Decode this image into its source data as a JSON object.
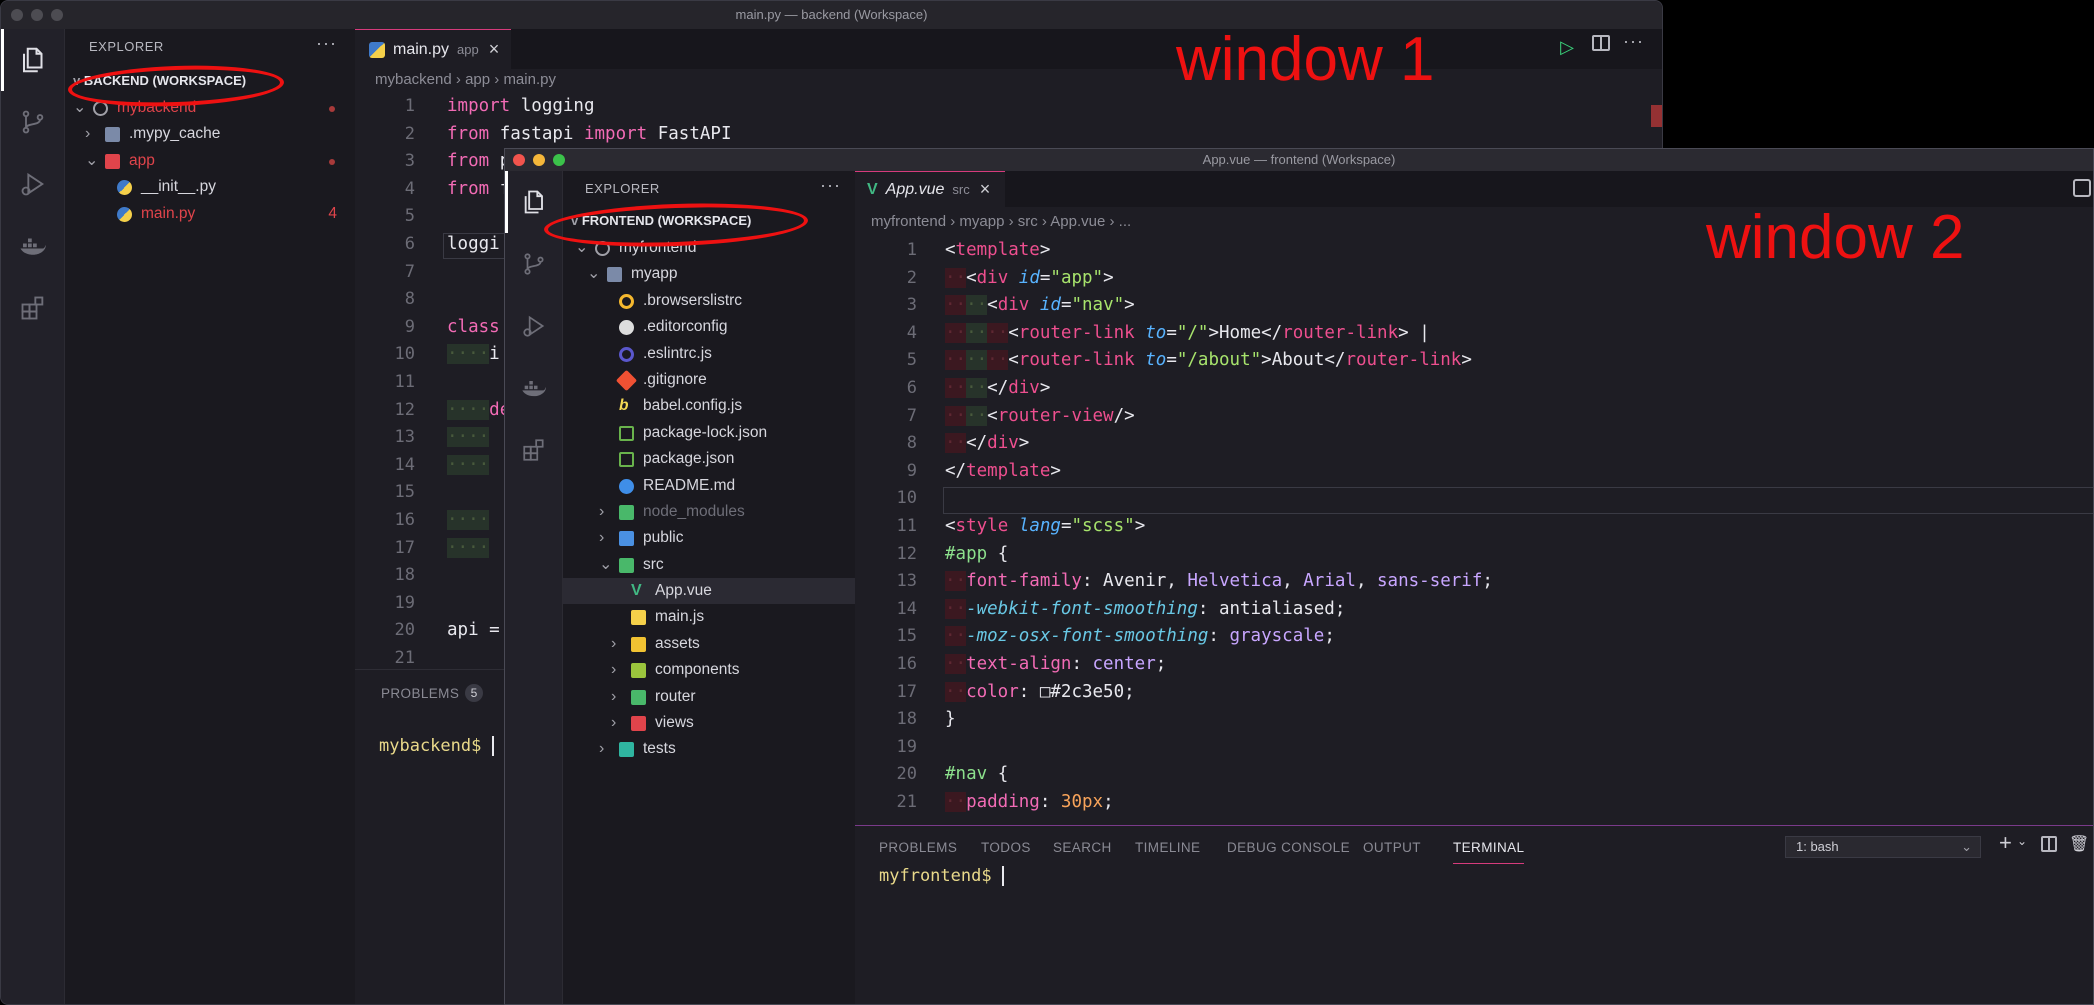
{
  "win1": {
    "title": "main.py — backend (Workspace)",
    "explorer_label": "EXPLORER",
    "workspace": "BACKEND (WORKSPACE)",
    "tree": [
      {
        "label": "mybackend",
        "indent": 1,
        "chev": "v",
        "color": "#e0444b",
        "icon": "circle"
      },
      {
        "label": ".mypy_cache",
        "indent": 2,
        "chev": ">",
        "color": "#d7d7de",
        "icon": "folder"
      },
      {
        "label": "app",
        "indent": 2,
        "chev": "v",
        "color": "#e0444b",
        "icon": "folder-red"
      },
      {
        "label": "__init__.py",
        "indent": 3,
        "chev": "",
        "color": "#d7d7de",
        "icon": "py"
      },
      {
        "label": "main.py",
        "indent": 3,
        "chev": "",
        "color": "#e0444b",
        "icon": "py",
        "badge": "4"
      }
    ],
    "tab": {
      "name": "main.py",
      "desc": "app",
      "close": "×"
    },
    "breadcrumb": [
      "mybackend",
      "app",
      "main.py"
    ],
    "line_numbers": [
      "1",
      "2",
      "3",
      "4",
      "5",
      "6",
      "7",
      "8",
      "9",
      "10",
      "11",
      "12",
      "13",
      "14",
      "15",
      "16",
      "17",
      "18",
      "19",
      "20",
      "21"
    ],
    "code_lines": [
      [
        [
          "k",
          "import"
        ],
        [
          "p",
          " logging"
        ]
      ],
      [
        [
          "k",
          "from"
        ],
        [
          "p",
          " fastapi "
        ],
        [
          "k",
          "import"
        ],
        [
          "p",
          " FastAPI"
        ]
      ],
      [
        [
          "k",
          "from"
        ],
        [
          "p",
          " p"
        ]
      ],
      [
        [
          "k",
          "from"
        ],
        [
          "p",
          " f"
        ]
      ],
      [
        [
          "p",
          ""
        ]
      ],
      [
        [
          "p",
          "loggi"
        ]
      ],
      [
        [
          "p",
          ""
        ]
      ],
      [
        [
          "p",
          ""
        ]
      ],
      [
        [
          "k",
          "class"
        ]
      ],
      [
        [
          "wg",
          "····"
        ],
        [
          "p",
          "i"
        ]
      ],
      [
        [
          "p",
          ""
        ]
      ],
      [
        [
          "wg",
          "····"
        ],
        [
          "k",
          "de"
        ]
      ],
      [
        [
          "wg",
          "····"
        ]
      ],
      [
        [
          "wg",
          "····"
        ]
      ],
      [
        [
          "p",
          ""
        ]
      ],
      [
        [
          "wg",
          "····"
        ]
      ],
      [
        [
          "wg",
          "····"
        ]
      ],
      [
        [
          "p",
          ""
        ]
      ],
      [
        [
          "p",
          ""
        ]
      ],
      [
        [
          "p",
          "api ="
        ]
      ],
      [
        [
          "p",
          ""
        ]
      ]
    ],
    "panel_tab": "PROBLEMS",
    "panel_badge": "5",
    "prompt": "mybackend$"
  },
  "win2": {
    "title": "App.vue — frontend (Workspace)",
    "explorer_label": "EXPLORER",
    "workspace": "FRONTEND (WORKSPACE)",
    "tree": [
      {
        "label": "myfrontend",
        "indent": 1,
        "chev": "v",
        "color": "#d7d7de",
        "icon": "circle"
      },
      {
        "label": "myapp",
        "indent": 2,
        "chev": "v",
        "color": "#d7d7de",
        "icon": "folder"
      },
      {
        "label": ".browserslistrc",
        "indent": 3,
        "chev": "",
        "color": "#d7d7de",
        "icon": "bl"
      },
      {
        "label": ".editorconfig",
        "indent": 3,
        "chev": "",
        "color": "#d7d7de",
        "icon": "ec"
      },
      {
        "label": ".eslintrc.js",
        "indent": 3,
        "chev": "",
        "color": "#d7d7de",
        "icon": "es"
      },
      {
        "label": ".gitignore",
        "indent": 3,
        "chev": "",
        "color": "#d7d7de",
        "icon": "git"
      },
      {
        "label": "babel.config.js",
        "indent": 3,
        "chev": "",
        "color": "#d7d7de",
        "icon": "babel"
      },
      {
        "label": "package-lock.json",
        "indent": 3,
        "chev": "",
        "color": "#d7d7de",
        "icon": "node"
      },
      {
        "label": "package.json",
        "indent": 3,
        "chev": "",
        "color": "#d7d7de",
        "icon": "node"
      },
      {
        "label": "README.md",
        "indent": 3,
        "chev": "",
        "color": "#d7d7de",
        "icon": "info"
      },
      {
        "label": "node_modules",
        "indent": 3,
        "chev": ">",
        "color": "#6e6e78",
        "icon": "folder-green"
      },
      {
        "label": "public",
        "indent": 3,
        "chev": ">",
        "color": "#d7d7de",
        "icon": "folder-blue"
      },
      {
        "label": "src",
        "indent": 3,
        "chev": "v",
        "color": "#d7d7de",
        "icon": "folder-green"
      },
      {
        "label": "App.vue",
        "indent": 4,
        "chev": "",
        "color": "#d7d7de",
        "icon": "vue",
        "selected": true
      },
      {
        "label": "main.js",
        "indent": 4,
        "chev": "",
        "color": "#d7d7de",
        "icon": "js"
      },
      {
        "label": "assets",
        "indent": 4,
        "chev": ">",
        "color": "#d7d7de",
        "icon": "folder-yellow"
      },
      {
        "label": "components",
        "indent": 4,
        "chev": ">",
        "color": "#d7d7de",
        "icon": "folder-lime"
      },
      {
        "label": "router",
        "indent": 4,
        "chev": ">",
        "color": "#d7d7de",
        "icon": "folder-green"
      },
      {
        "label": "views",
        "indent": 4,
        "chev": ">",
        "color": "#d7d7de",
        "icon": "folder-red"
      },
      {
        "label": "tests",
        "indent": 3,
        "chev": ">",
        "color": "#d7d7de",
        "icon": "folder-teal"
      }
    ],
    "tab": {
      "name": "App.vue",
      "desc": "src",
      "close": "×"
    },
    "breadcrumb": [
      "myfrontend",
      "myapp",
      "src",
      "App.vue",
      "..."
    ],
    "line_numbers": [
      "1",
      "2",
      "3",
      "4",
      "5",
      "6",
      "7",
      "8",
      "9",
      "10",
      "11",
      "12",
      "13",
      "14",
      "15",
      "16",
      "17",
      "18",
      "19",
      "20",
      "21"
    ],
    "code_lines": [
      [
        [
          "p",
          "<"
        ],
        [
          "t",
          "template"
        ],
        [
          "p",
          ">"
        ]
      ],
      [
        [
          "ws",
          "··"
        ],
        [
          "p",
          "<"
        ],
        [
          "t",
          "div"
        ],
        [
          "p",
          " "
        ],
        [
          "a",
          "id"
        ],
        [
          "p",
          "="
        ],
        [
          "s",
          "\"app\""
        ],
        [
          "p",
          ">"
        ]
      ],
      [
        [
          "ws",
          "··"
        ],
        [
          "wg",
          "··"
        ],
        [
          "p",
          "<"
        ],
        [
          "t",
          "div"
        ],
        [
          "p",
          " "
        ],
        [
          "a",
          "id"
        ],
        [
          "p",
          "="
        ],
        [
          "s",
          "\"nav\""
        ],
        [
          "p",
          ">"
        ]
      ],
      [
        [
          "ws",
          "··"
        ],
        [
          "wg",
          "··"
        ],
        [
          "ws",
          "··"
        ],
        [
          "p",
          "<"
        ],
        [
          "t",
          "router-link"
        ],
        [
          "p",
          " "
        ],
        [
          "a",
          "to"
        ],
        [
          "p",
          "="
        ],
        [
          "s",
          "\"/\""
        ],
        [
          "p",
          ">Home</"
        ],
        [
          "t",
          "router-link"
        ],
        [
          "p",
          "> |"
        ]
      ],
      [
        [
          "ws",
          "··"
        ],
        [
          "wg",
          "··"
        ],
        [
          "ws",
          "··"
        ],
        [
          "p",
          "<"
        ],
        [
          "t",
          "router-link"
        ],
        [
          "p",
          " "
        ],
        [
          "a",
          "to"
        ],
        [
          "p",
          "="
        ],
        [
          "s",
          "\"/about\""
        ],
        [
          "p",
          ">About</"
        ],
        [
          "t",
          "router-link"
        ],
        [
          "p",
          ">"
        ]
      ],
      [
        [
          "ws",
          "··"
        ],
        [
          "wg",
          "··"
        ],
        [
          "p",
          "</"
        ],
        [
          "t",
          "div"
        ],
        [
          "p",
          ">"
        ]
      ],
      [
        [
          "ws",
          "··"
        ],
        [
          "wg",
          "··"
        ],
        [
          "p",
          "<"
        ],
        [
          "t",
          "router-view"
        ],
        [
          "p",
          "/>"
        ]
      ],
      [
        [
          "ws",
          "··"
        ],
        [
          "p",
          "</"
        ],
        [
          "t",
          "div"
        ],
        [
          "p",
          ">"
        ]
      ],
      [
        [
          "p",
          "</"
        ],
        [
          "t",
          "template"
        ],
        [
          "p",
          ">"
        ]
      ],
      [
        [
          "p",
          ""
        ]
      ],
      [
        [
          "p",
          "<"
        ],
        [
          "t",
          "style"
        ],
        [
          "p",
          " "
        ],
        [
          "a",
          "lang"
        ],
        [
          "p",
          "="
        ],
        [
          "s",
          "\"scss\""
        ],
        [
          "p",
          ">"
        ]
      ],
      [
        [
          "g",
          "#app"
        ],
        [
          "p",
          " {"
        ]
      ],
      [
        [
          "ws",
          "··"
        ],
        [
          "k",
          "font-family"
        ],
        [
          "p",
          ": Avenir, "
        ],
        [
          "v",
          "Helvetica"
        ],
        [
          "p",
          ", "
        ],
        [
          "v",
          "Arial"
        ],
        [
          "p",
          ", "
        ],
        [
          "v",
          "sans-serif"
        ],
        [
          "p",
          ";"
        ]
      ],
      [
        [
          "ws",
          "··"
        ],
        [
          "c",
          "-webkit-font-smoothing"
        ],
        [
          "p",
          ": antialiased;"
        ]
      ],
      [
        [
          "ws",
          "··"
        ],
        [
          "c",
          "-moz-osx-font-smoothing"
        ],
        [
          "p",
          ": "
        ],
        [
          "v",
          "grayscale"
        ],
        [
          "p",
          ";"
        ]
      ],
      [
        [
          "ws",
          "··"
        ],
        [
          "k",
          "text-align"
        ],
        [
          "p",
          ": "
        ],
        [
          "v",
          "center"
        ],
        [
          "p",
          ";"
        ]
      ],
      [
        [
          "ws",
          "··"
        ],
        [
          "k",
          "color"
        ],
        [
          "p",
          ": □#2c3e50;"
        ]
      ],
      [
        [
          "p",
          "}"
        ]
      ],
      [
        [
          "p",
          ""
        ]
      ],
      [
        [
          "g",
          "#nav"
        ],
        [
          "p",
          " {"
        ]
      ],
      [
        [
          "ws",
          "··"
        ],
        [
          "k",
          "padding"
        ],
        [
          "p",
          ": "
        ],
        [
          "n",
          "30px"
        ],
        [
          "p",
          ";"
        ]
      ]
    ],
    "panel_tabs": [
      "PROBLEMS",
      "TODOS",
      "SEARCH",
      "TIMELINE",
      "DEBUG CONSOLE",
      "OUTPUT",
      "TERMINAL"
    ],
    "terminal_select": "1: bash",
    "prompt": "myfrontend$"
  },
  "annotations": {
    "w1": "window 1",
    "w2": "window 2"
  },
  "colors": {
    "accent": "#d63b7c",
    "annotation": "#ee1111"
  }
}
